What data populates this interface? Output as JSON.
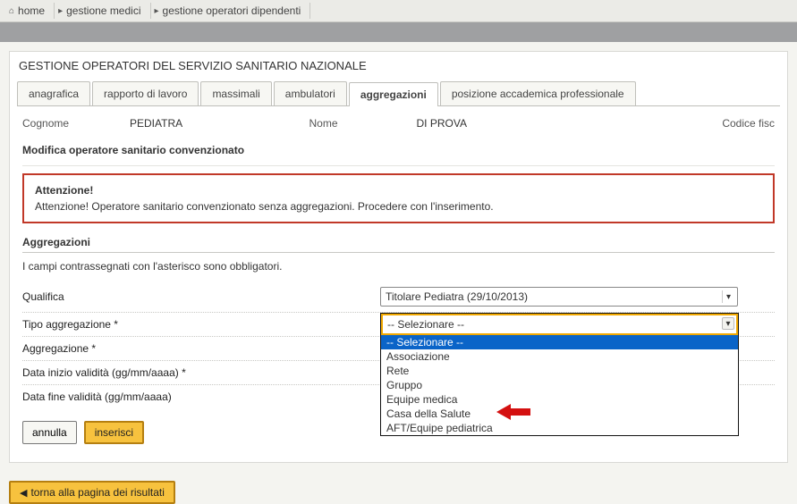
{
  "breadcrumb": {
    "home": "home",
    "b1": "gestione medici",
    "b2": "gestione operatori dipendenti"
  },
  "panel": {
    "title": "GESTIONE OPERATORI DEL SERVIZIO SANITARIO NAZIONALE"
  },
  "tabs": {
    "anagrafica": "anagrafica",
    "rapporto": "rapporto di lavoro",
    "massimali": "massimali",
    "ambulatori": "ambulatori",
    "aggregazioni": "aggregazioni",
    "posizione": "posizione accademica professionale"
  },
  "info": {
    "cognome_label": "Cognome",
    "cognome_val": "PEDIATRA",
    "nome_label": "Nome",
    "nome_val": "DI PROVA",
    "cf_label": "Codice fisc"
  },
  "section": {
    "modifica": "Modifica operatore sanitario convenzionato"
  },
  "alert": {
    "title": "Attenzione!",
    "body": "Attenzione! Operatore sanitario convenzionato senza aggregazioni. Procedere con l'inserimento."
  },
  "group": {
    "title": "Aggregazioni",
    "note": "I campi contrassegnati con l'asterisco sono obbligatori."
  },
  "form": {
    "qualifica_label": "Qualifica",
    "qualifica_value": "Titolare Pediatra (29/10/2013)",
    "tipo_label": "Tipo aggregazione *",
    "tipo_value": "-- Selezionare --",
    "aggreg_label": "Aggregazione *",
    "dini_label": "Data inizio validità (gg/mm/aaaa) *",
    "dfin_label": "Data fine validità (gg/mm/aaaa)"
  },
  "dropdown": {
    "head": "-- Selezionare --",
    "items": [
      "-- Selezionare --",
      "Associazione",
      "Rete",
      "Gruppo",
      "Equipe medica",
      "Casa della Salute",
      "AFT/Equipe pediatrica"
    ]
  },
  "buttons": {
    "annulla": "annulla",
    "inserisci": "inserisci",
    "back": "torna alla pagina dei risultati"
  }
}
